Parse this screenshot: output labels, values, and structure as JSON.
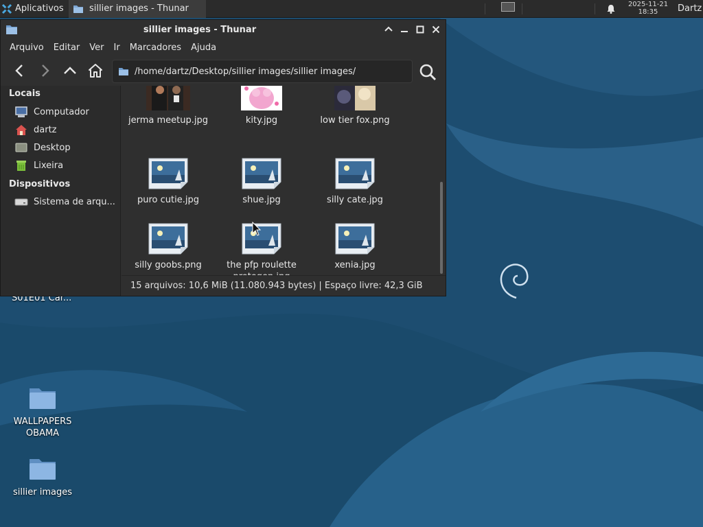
{
  "panel": {
    "apps_label": "Aplicativos",
    "task_title": "sillier images - Thunar",
    "clock_date": "2025-11-21",
    "clock_time": "18:35",
    "user": "Dartz"
  },
  "window": {
    "title": "sillier images - Thunar",
    "menu": [
      "Arquivo",
      "Editar",
      "Ver",
      "Ir",
      "Marcadores",
      "Ajuda"
    ],
    "location": "/home/dartz/Desktop/sillier images/sillier images/"
  },
  "sidebar": {
    "places_header": "Locais",
    "places": [
      "Computador",
      "dartz",
      "Desktop",
      "Lixeira"
    ],
    "devices_header": "Dispositivos",
    "devices": [
      "Sistema de arqu..."
    ]
  },
  "files": [
    {
      "name": "jerma meetup.jpg"
    },
    {
      "name": "kity.jpg"
    },
    {
      "name": "low tier fox.png"
    },
    {
      "name": "puro cutie.jpg"
    },
    {
      "name": "shue.jpg"
    },
    {
      "name": "silly cate.jpg"
    },
    {
      "name": "silly goobs.png"
    },
    {
      "name": "the pfp roulette protogen.jpg"
    },
    {
      "name": "xenia.jpg"
    }
  ],
  "status": "15 arquivos: 10,6 MiB (11.080.943 bytes)  |  Espaço livre: 42,3 GiB",
  "desktop": {
    "partial_label": "S01E01 Car...",
    "icons": [
      {
        "label": "WALLPAPERS OBAMA"
      },
      {
        "label": "sillier images"
      }
    ]
  },
  "colors": {
    "panel": "#2b2b2b",
    "window": "#2f2f2f",
    "desktop": "#1d4e72"
  }
}
